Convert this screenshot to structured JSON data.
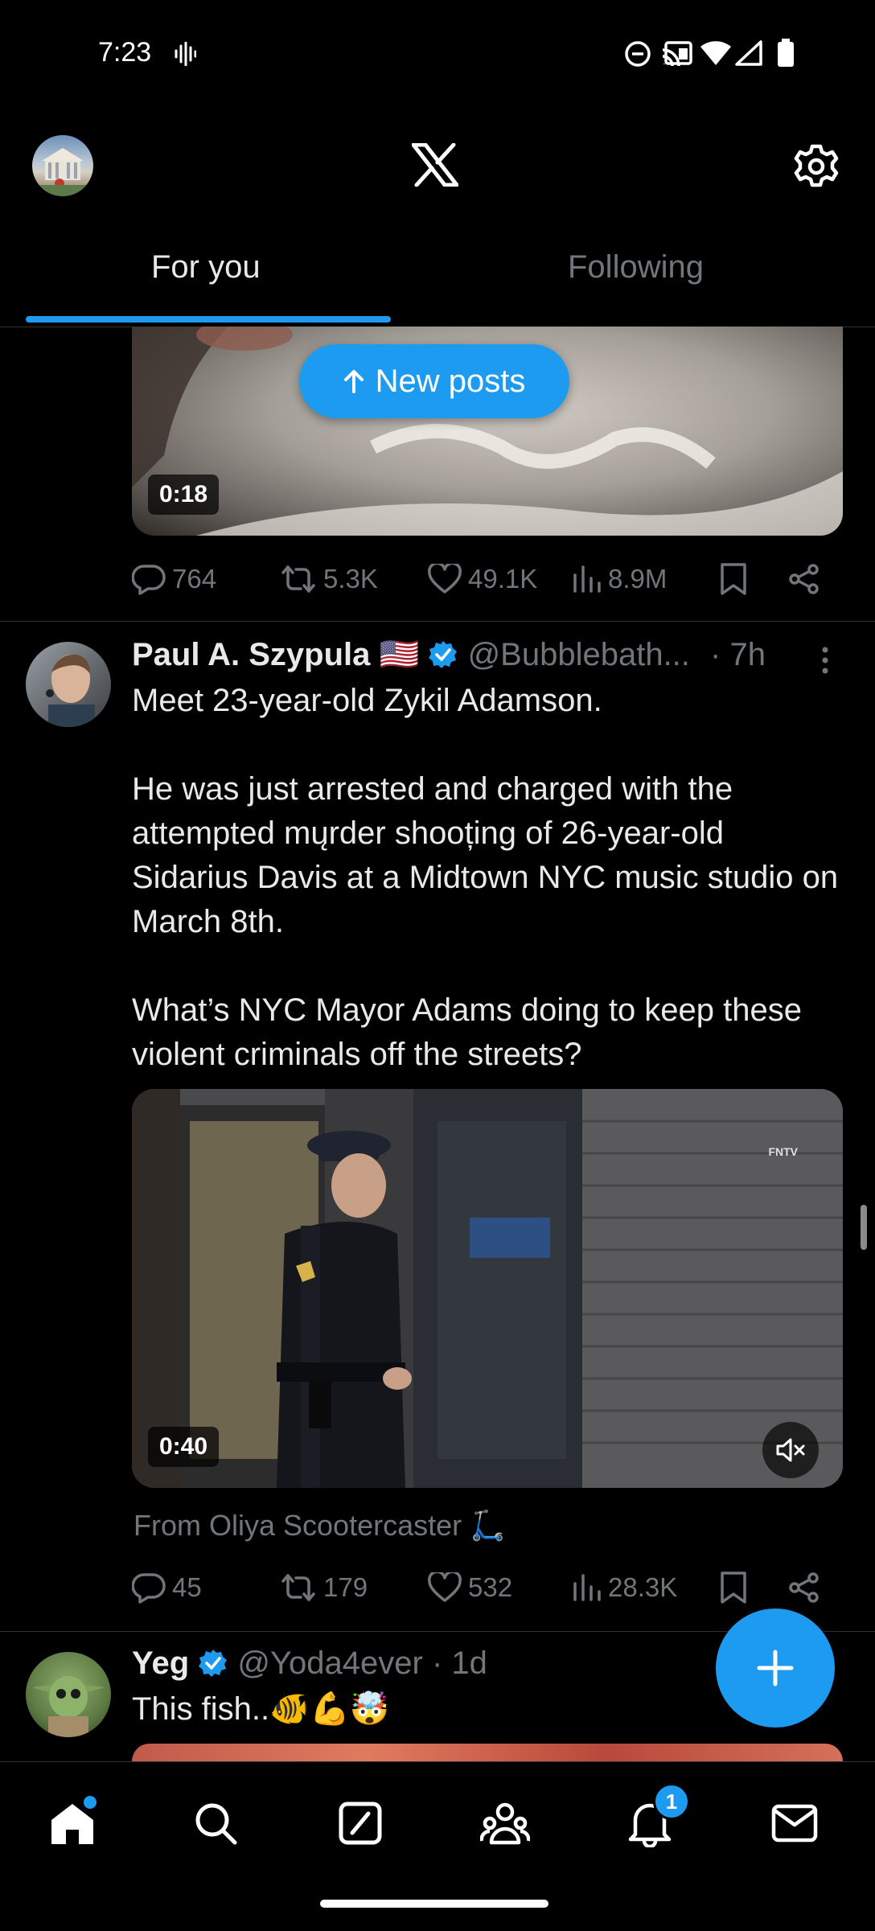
{
  "status_bar": {
    "time": "7:23"
  },
  "header": {
    "logo": "X"
  },
  "tabs": [
    {
      "label": "For you",
      "active": true
    },
    {
      "label": "Following",
      "active": false
    }
  ],
  "new_posts": {
    "label": "New posts"
  },
  "post1": {
    "video_duration": "0:18",
    "stats": {
      "replies": "764",
      "reposts": "5.3K",
      "likes": "49.1K",
      "views": "8.9M"
    }
  },
  "post2": {
    "name": "Paul A. Szypula",
    "flag": "🇺🇸",
    "handle": "@Bubblebath...",
    "time": "· 7h",
    "text_p1": "Meet 23-year-old Zykil Adamson.",
    "text_p2": "He was just arrested and charged with the attempted mųrder shooțing of 26-year-old Sidarius Davis at a Midtown NYC music studio on March 8th.",
    "text_p3": "What’s NYC Mayor Adams doing to keep these violent criminals off the streets?",
    "video_duration": "0:40",
    "video_watermark": "FNTV",
    "from_line": "From Oliya Scootercaster 🛴",
    "stats": {
      "replies": "45",
      "reposts": "179",
      "likes": "532",
      "views": "28.3K"
    }
  },
  "post3": {
    "name": "Yeg",
    "handle": "@Yoda4ever",
    "time": "· 1d",
    "text": "This fish..🐠💪🤯"
  },
  "nav": {
    "notifications_badge": "1"
  },
  "colors": {
    "accent": "#1d9bf0",
    "background": "#000000",
    "muted": "#71767b",
    "text": "#e7e9ea"
  }
}
